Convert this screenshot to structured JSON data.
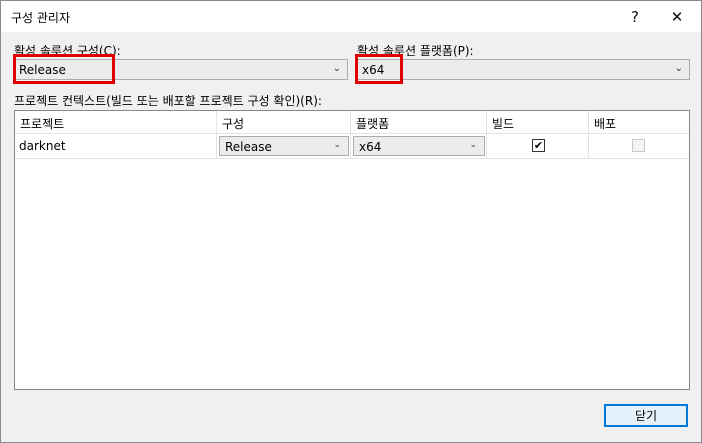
{
  "window": {
    "title": "구성 관리자",
    "help_glyph": "?",
    "close_glyph": "✕"
  },
  "solution_config": {
    "label": "활성 솔루션 구성(C):",
    "value": "Release"
  },
  "solution_platform": {
    "label": "활성 솔루션 플랫폼(P):",
    "value": "x64"
  },
  "project_contexts_label": "프로젝트 컨텍스트(빌드 또는 배포할 프로젝트 구성 확인)(R):",
  "table": {
    "headers": [
      "프로젝트",
      "구성",
      "플랫폼",
      "빌드",
      "배포"
    ],
    "rows": [
      {
        "project": "darknet",
        "configuration": "Release",
        "platform": "x64",
        "build": true,
        "deploy": false
      }
    ]
  },
  "footer": {
    "close_label": "닫기"
  },
  "highlight_color": "#e00000"
}
